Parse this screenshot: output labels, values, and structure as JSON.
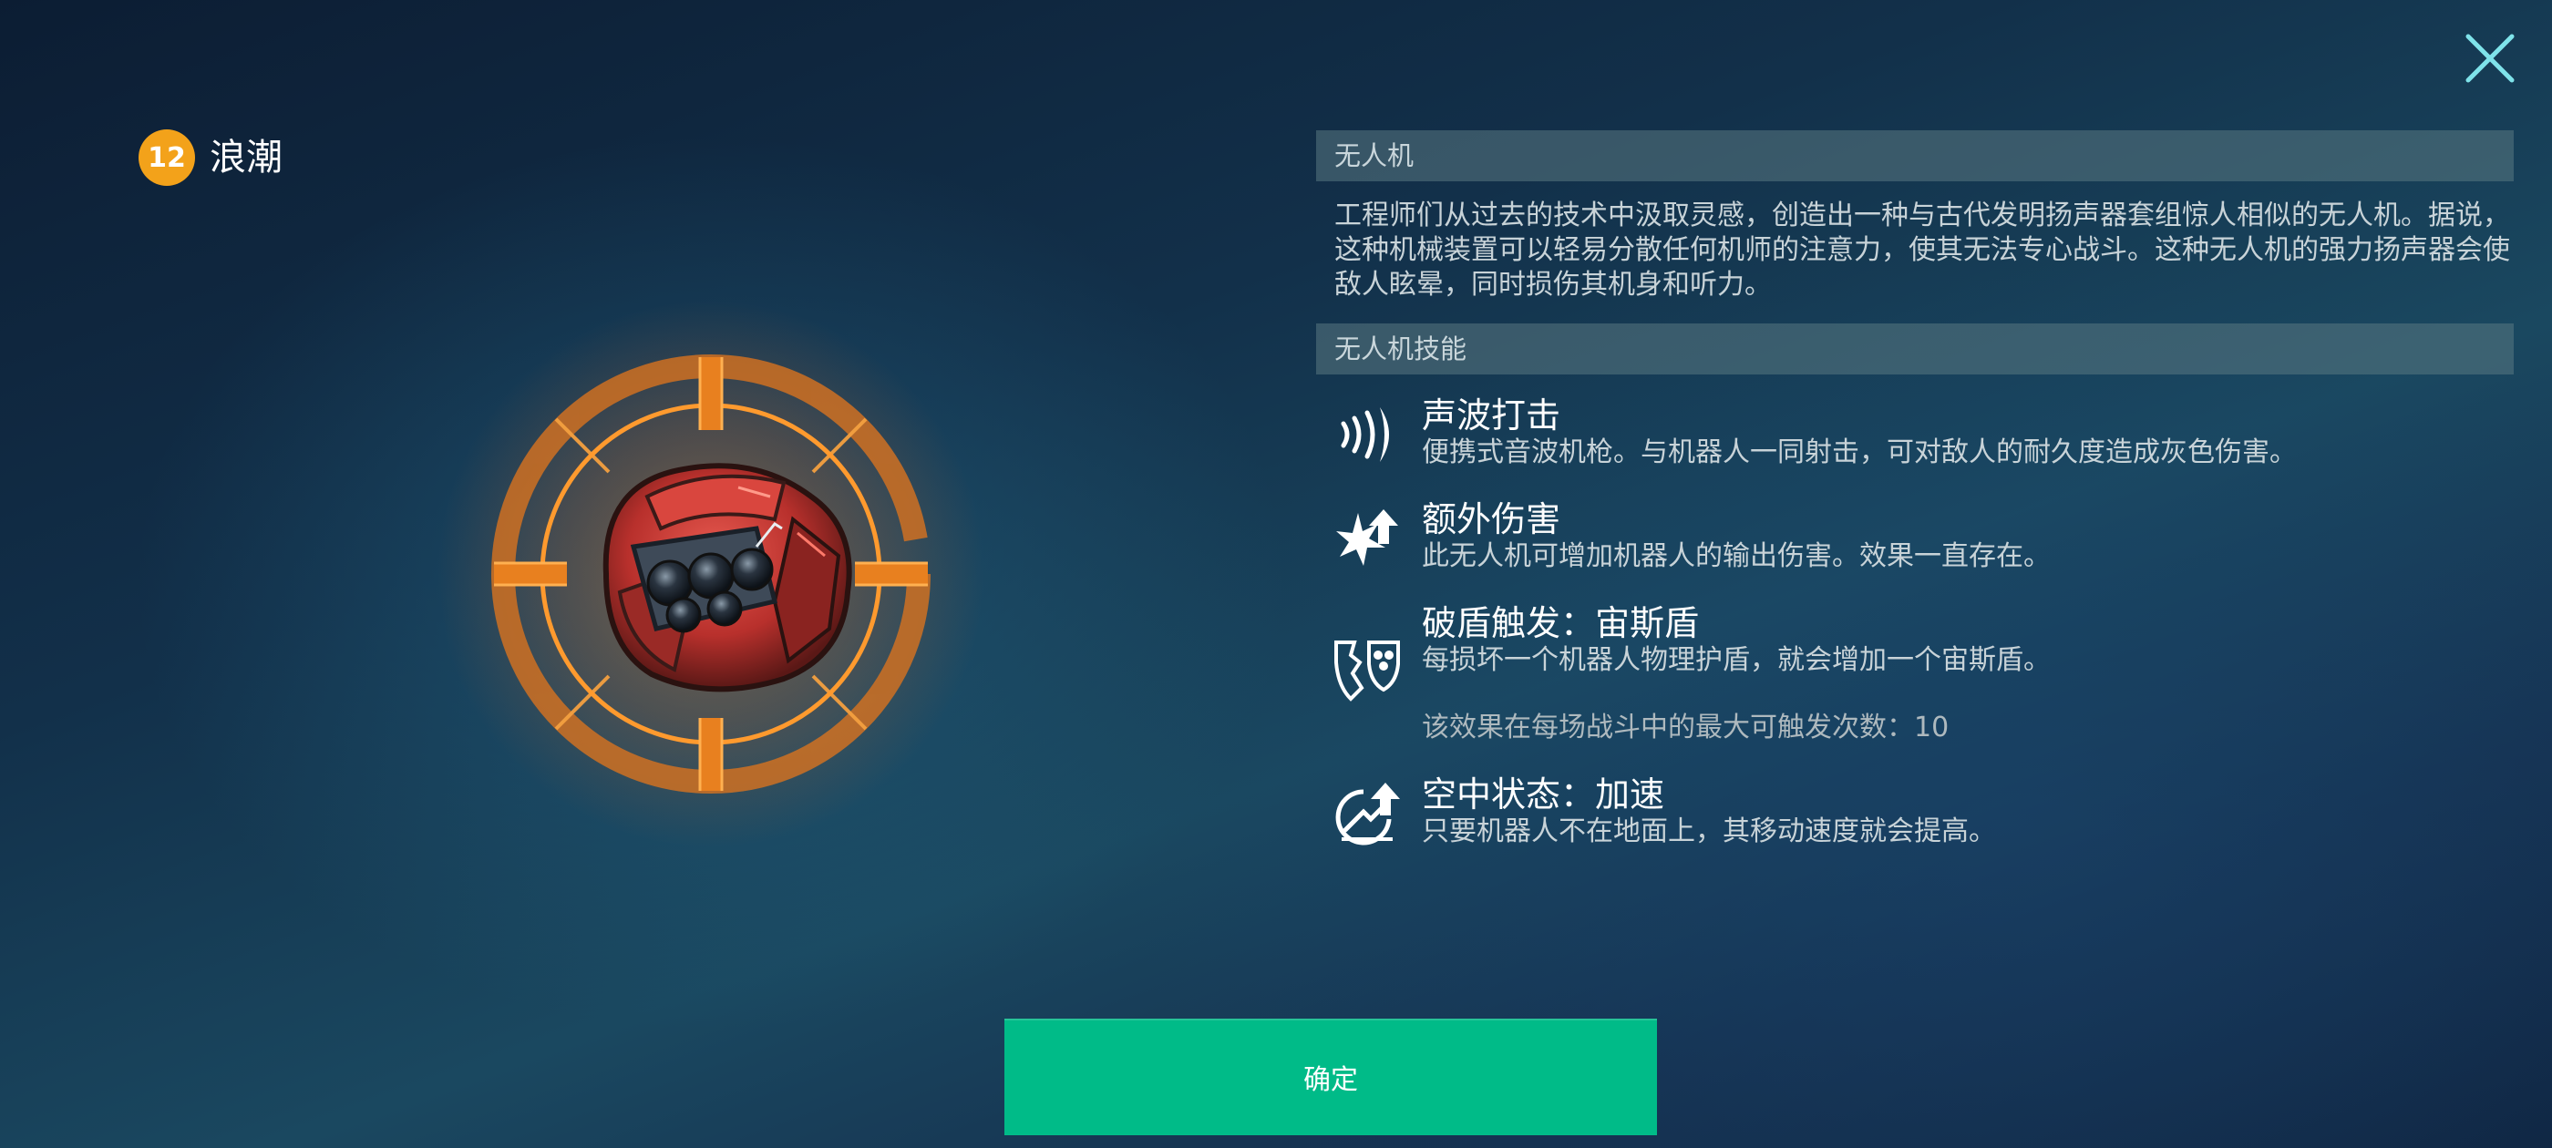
{
  "close": {
    "icon": "close-icon"
  },
  "header": {
    "level": "12",
    "name": "浪潮"
  },
  "artwork": {
    "icon": "drone-artwork"
  },
  "drone_section": {
    "title": "无人机",
    "description": "工程师们从过去的技术中汲取灵感，创造出一种与古代发明扬声器套组惊人相似的无人机。据说，这种机械装置可以轻易分散任何机师的注意力，使其无法专心战斗。这种无人机的强力扬声器会使敌人眩晕，同时损伤其机身和听力。"
  },
  "skills_section": {
    "title": "无人机技能",
    "skills": [
      {
        "icon": "sonic-wave-icon",
        "title": "声波打击",
        "text": "便携式音波机枪。与机器人一同射击，可对敌人的耐久度造成灰色伤害。"
      },
      {
        "icon": "extra-damage-icon",
        "title": "额外伤害",
        "text": "此无人机可增加机器人的输出伤害。效果一直存在。"
      },
      {
        "icon": "shield-break-icon",
        "title": "破盾触发：宙斯盾",
        "text": "每损坏一个机器人物理护盾，就会增加一个宙斯盾。",
        "extra": "该效果在每场战斗中的最大可触发次数：10"
      },
      {
        "icon": "airborne-speed-icon",
        "title": "空中状态：加速",
        "text": "只要机器人不在地面上，其移动速度就会提高。"
      }
    ]
  },
  "confirm_button": {
    "label": "确定"
  },
  "colors": {
    "accent_green": "#00bb88",
    "level_badge": "#f3a21a",
    "reticle_orange": "#f08a1c"
  }
}
